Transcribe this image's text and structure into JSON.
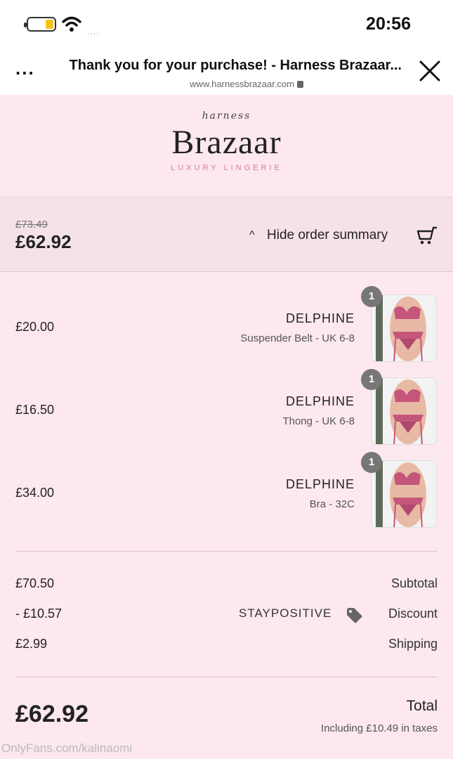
{
  "status_bar": {
    "time": "20:56",
    "signal": "...."
  },
  "browser": {
    "title": "Thank you for your purchase! - Harness Brazaar...",
    "url": "www.harnessbrazaar.com",
    "more": "..."
  },
  "brand": {
    "script": "harness",
    "name": "Brazaar",
    "tagline": "LUXURY LINGERIE"
  },
  "summary": {
    "toggle_label": "Hide order summary",
    "chevron": "^",
    "old_price": "£73.49",
    "total": "£62.92"
  },
  "items": [
    {
      "qty": "1",
      "name": "DELPHINE",
      "variant": "Suspender Belt - UK 6-8",
      "price": "£20.00"
    },
    {
      "qty": "1",
      "name": "DELPHINE",
      "variant": "Thong - UK 6-8",
      "price": "£16.50"
    },
    {
      "qty": "1",
      "name": "DELPHINE",
      "variant": "Bra - 32C",
      "price": "£34.00"
    }
  ],
  "totals": {
    "subtotal_label": "Subtotal",
    "subtotal": "£70.50",
    "discount_label": "Discount",
    "discount_code": "STAYPOSITIVE",
    "discount": "- £10.57",
    "shipping_label": "Shipping",
    "shipping": "£2.99",
    "total_label": "Total",
    "tax_note": "Including £10.49 in taxes",
    "total": "£62.92"
  },
  "watermark": "OnlyFans.com/kalinaomi",
  "icons": {
    "cart": "cart-icon",
    "close": "close-icon",
    "tag": "tag-icon",
    "lock": "lock-icon"
  },
  "colors": {
    "header_bg": "#fce8ee",
    "toggle_bg": "#f5e2e8",
    "accent": "#d97a8e"
  }
}
